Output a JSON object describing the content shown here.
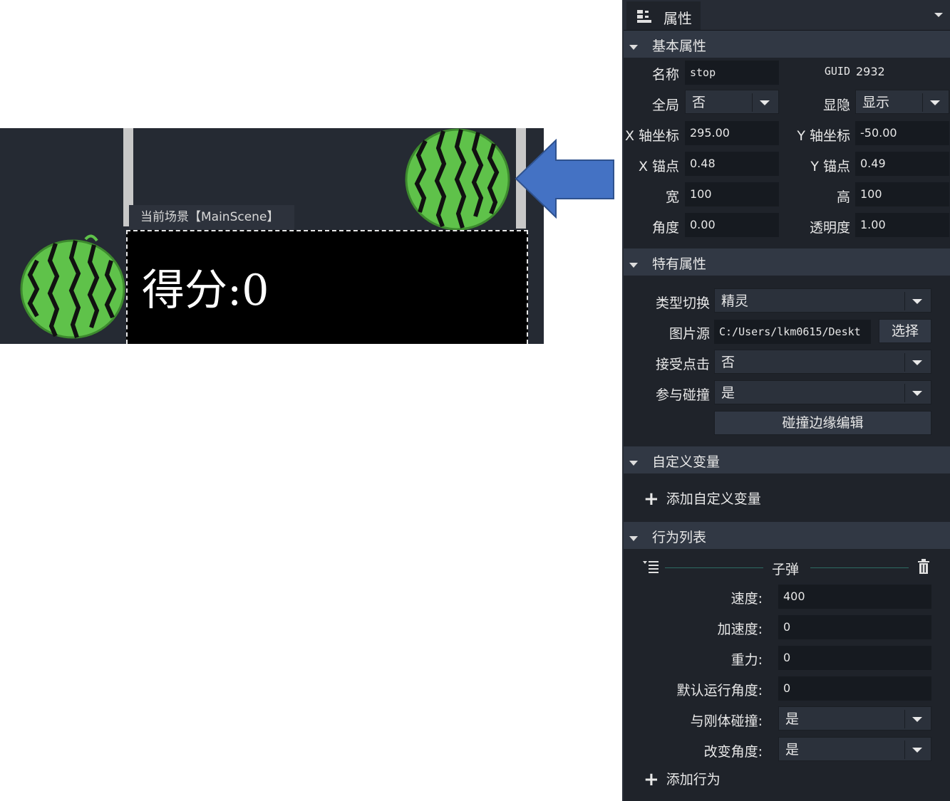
{
  "scene": {
    "tab_label": "当前场景【MainScene】",
    "score_text": "得分:0"
  },
  "panel": {
    "tab_label": "属性",
    "sections": {
      "basic": "基本属性",
      "special": "特有属性",
      "custom_vars": "自定义变量",
      "behaviors": "行为列表"
    },
    "basic": {
      "name_label": "名称",
      "name_value": "stop",
      "guid_label": "GUID",
      "guid_value": "2932",
      "global_label": "全局",
      "global_value": "否",
      "visible_label": "显隐",
      "visible_value": "显示",
      "x_label": "X 轴坐标",
      "x_value": "295.00",
      "y_label": "Y 轴坐标",
      "y_value": "-50.00",
      "ax_label": "X 锚点",
      "ax_value": "0.48",
      "ay_label": "Y 锚点",
      "ay_value": "0.49",
      "width_label": "宽",
      "width_value": "100",
      "height_label": "高",
      "height_value": "100",
      "angle_label": "角度",
      "angle_value": "0.00",
      "opacity_label": "透明度",
      "opacity_value": "1.00"
    },
    "special": {
      "type_label": "类型切换",
      "type_value": "精灵",
      "image_label": "图片源",
      "image_value": "C:/Users/lkm0615/Deskt",
      "image_button": "选择",
      "click_label": "接受点击",
      "click_value": "否",
      "collide_label": "参与碰撞",
      "collide_value": "是",
      "edge_button": "碰撞边缘编辑"
    },
    "custom_vars": {
      "add_label": "添加自定义变量"
    },
    "behaviors": {
      "item_title": "子弹",
      "speed_label": "速度:",
      "speed_value": "400",
      "accel_label": "加速度:",
      "accel_value": "0",
      "gravity_label": "重力:",
      "gravity_value": "0",
      "default_angle_label": "默认运行角度:",
      "default_angle_value": "0",
      "rigid_label": "与刚体碰撞:",
      "rigid_value": "是",
      "change_angle_label": "改变角度:",
      "change_angle_value": "是",
      "add_label": "添加行为"
    }
  },
  "colors": {
    "arrow": "#4472c4",
    "panel_bg": "#1f232a",
    "section_bg": "#313844",
    "melon_green": "#5fc24a"
  },
  "icons": [
    "properties-icon",
    "delete-icon",
    "collapse-list-icon",
    "plus-icon",
    "dropdown-icon"
  ]
}
